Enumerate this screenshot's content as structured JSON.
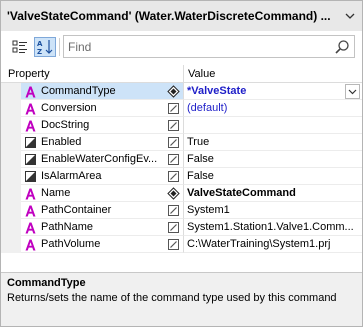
{
  "window": {
    "title": "'ValveStateCommand' (Water.WaterDiscreteCommand) ..."
  },
  "toolbar": {
    "categorized_icon": "categorized-list-icon",
    "alphabetical_icon": "sort-alphabetical-icon",
    "search_placeholder": "Find",
    "search_value": ""
  },
  "grid": {
    "property_header": "Property",
    "value_header": "Value",
    "rows": [
      {
        "name": "CommandType",
        "value": "*ValveState",
        "icon": "attribute-icon",
        "mark": "diamond",
        "value_style": "bold-blue",
        "selected": true
      },
      {
        "name": "Conversion",
        "value": "(default)",
        "icon": "attribute-icon",
        "mark": "edit",
        "value_style": "blue",
        "selected": false
      },
      {
        "name": "DocString",
        "value": "",
        "icon": "attribute-icon",
        "mark": "edit",
        "value_style": "normal",
        "selected": false
      },
      {
        "name": "Enabled",
        "value": "True",
        "icon": "boolean-icon",
        "mark": "edit",
        "value_style": "normal",
        "selected": false
      },
      {
        "name": "EnableWaterConfigEv...",
        "value": "False",
        "icon": "boolean-icon",
        "mark": "edit",
        "value_style": "normal",
        "selected": false
      },
      {
        "name": "IsAlarmArea",
        "value": "False",
        "icon": "boolean-icon",
        "mark": "edit",
        "value_style": "normal",
        "selected": false
      },
      {
        "name": "Name",
        "value": "ValveStateCommand",
        "icon": "attribute-icon",
        "mark": "diamond",
        "value_style": "bold",
        "selected": false
      },
      {
        "name": "PathContainer",
        "value": "System1",
        "icon": "attribute-icon",
        "mark": "edit",
        "value_style": "normal",
        "selected": false
      },
      {
        "name": "PathName",
        "value": "System1.Station1.Valve1.Comm...",
        "icon": "attribute-icon",
        "mark": "edit",
        "value_style": "normal",
        "selected": false
      },
      {
        "name": "PathVolume",
        "value": "C:\\WaterTraining\\System1.prj",
        "icon": "attribute-icon",
        "mark": "edit",
        "value_style": "normal",
        "selected": false
      }
    ]
  },
  "description": {
    "title": "CommandType",
    "text": "Returns/sets the name of the command type used by this command"
  },
  "colors": {
    "attribute_icon": "#c000c0",
    "value_blue": "#1e1ec8",
    "selection": "#cde3f8"
  }
}
